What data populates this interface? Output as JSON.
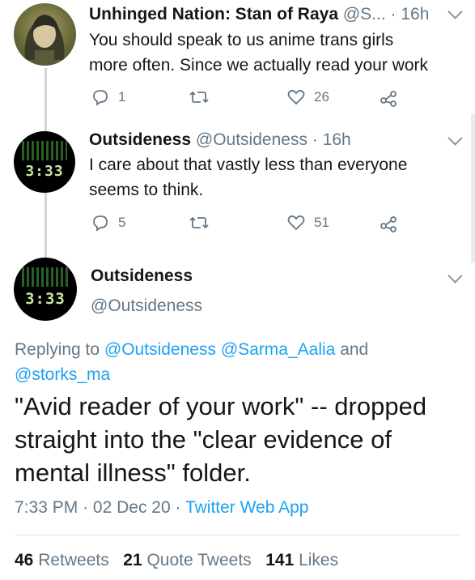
{
  "tweets": [
    {
      "name": "Unhinged Nation: Stan of Raya",
      "handle": "@S...",
      "sep": "·",
      "time": "16h",
      "line1": "You should speak to us anime trans girls",
      "line2": "more often. Since we actually read your work",
      "replies": "1",
      "retweets": "",
      "likes": "26"
    },
    {
      "name": "Outsideness",
      "handle": "@Outsideness",
      "sep": "·",
      "time": "16h",
      "line1": "I care about that vastly less than everyone",
      "line2": "seems to think.",
      "replies": "5",
      "retweets": "",
      "likes": "51",
      "avatar_text": "3:33"
    }
  ],
  "main": {
    "name": "Outsideness",
    "handle": "@Outsideness",
    "avatar_text": "3:33",
    "replying_prefix": "Replying to ",
    "reply_mentions": [
      "@Outsideness",
      "@Sarma_Aalia",
      "@storks_ma"
    ],
    "replying_and": " and",
    "text_line1": "\"Avid reader of your work\" -- dropped",
    "text_line2": "straight into the \"clear evidence of",
    "text_line3": "mental illness\" folder.",
    "time": "7:33 PM",
    "date": "02 Dec 20",
    "client": "Twitter Web App",
    "sep": "·",
    "retweets_count": "46",
    "retweets_label": "Retweets",
    "quotes_count": "21",
    "quotes_label": "Quote Tweets",
    "likes_count": "141",
    "likes_label": "Likes"
  },
  "colors": {
    "link": "#1da1f2",
    "muted": "#657786",
    "text": "#14171a"
  },
  "icons": [
    "reply-icon",
    "retweet-icon",
    "like-icon",
    "share-icon",
    "chevron-down-icon"
  ]
}
